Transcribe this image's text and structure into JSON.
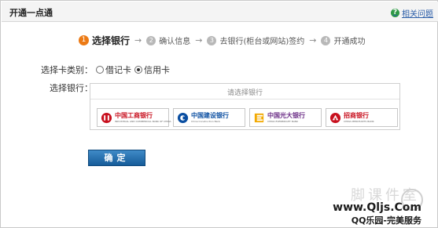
{
  "header": {
    "title": "开通一点通",
    "help_link": "相关问题",
    "help_icon": "question-icon"
  },
  "steps": [
    {
      "num": "1",
      "label": "选择银行",
      "active": true
    },
    {
      "num": "2",
      "label": "确认信息",
      "active": false
    },
    {
      "num": "3",
      "label": "去银行(柜台或网站)签约",
      "active": false
    },
    {
      "num": "4",
      "label": "开通成功",
      "active": false
    }
  ],
  "step_arrow": "→",
  "card_type": {
    "label": "选择卡类别：",
    "options": [
      {
        "label": "借记卡",
        "checked": false
      },
      {
        "label": "信用卡",
        "checked": true
      }
    ]
  },
  "bank_select": {
    "label": "选择银行：",
    "hint": "请选择银行",
    "banks": [
      {
        "name": "中国工商银行",
        "en": "INDUSTRIAL AND COMMERCIAL BANK OF CHINA",
        "color": "#c8101e",
        "icon": "icbc-logo-icon"
      },
      {
        "name": "中国建设银行",
        "en": "China Construction Bank",
        "color": "#0a4ea1",
        "icon": "ccb-logo-icon"
      },
      {
        "name": "中国光大银行",
        "en": "CHINA EVERBRIGHT BANK",
        "color": "#6b2d86",
        "icon": "cebbank-logo-icon"
      },
      {
        "name": "招商银行",
        "en": "CHINA MERCHANTS BANK",
        "color": "#c8101e",
        "icon": "cmb-logo-icon"
      }
    ]
  },
  "confirm_button": "确定",
  "watermark": {
    "faded_text": "脚课件室",
    "url": "www.Qljs.Com",
    "slogan": "QQ乐园-完美服务"
  }
}
